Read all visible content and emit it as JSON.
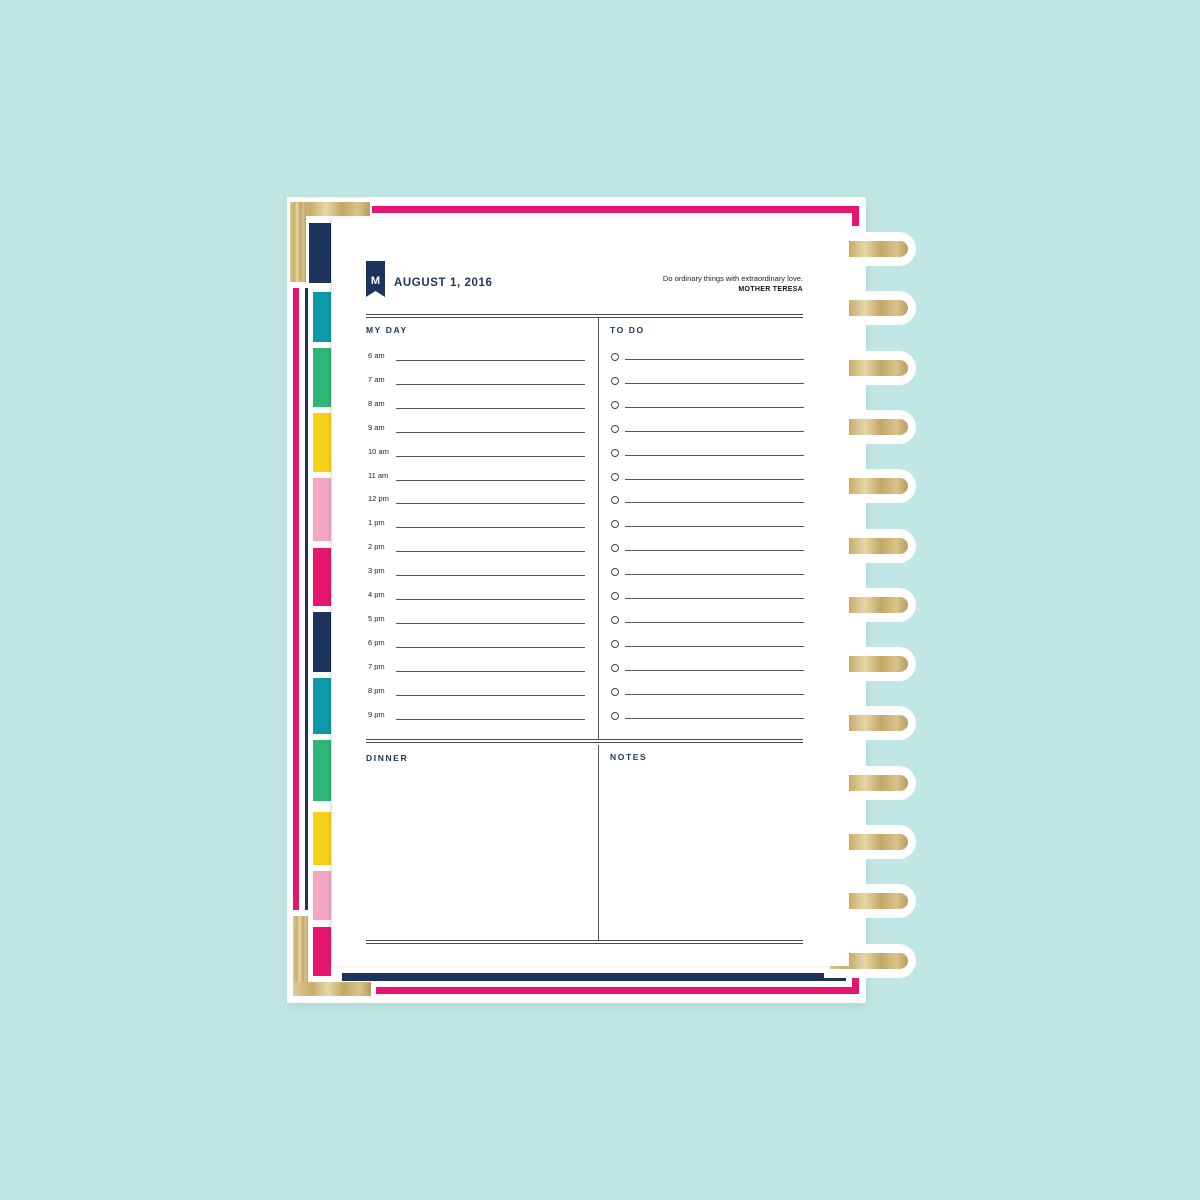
{
  "planner": {
    "date": "AUGUST 1, 2016",
    "monogram": "M",
    "quote": "Do ordinary things with extraordinary love.",
    "quote_author": "MOTHER TERESA",
    "sections": {
      "my_day": "MY DAY",
      "to_do": "TO DO",
      "dinner": "DINNER",
      "notes": "NOTES"
    },
    "hours": [
      "6 am",
      "7 am",
      "8 am",
      "9 am",
      "10 am",
      "11 am",
      "12 pm",
      "1 pm",
      "2 pm",
      "3 pm",
      "4 pm",
      "5 pm",
      "6 pm",
      "7 pm",
      "8 pm",
      "9 pm"
    ],
    "todo_count": 16,
    "ring_count": 13
  },
  "colors": {
    "background": "#c0e7e6",
    "pink": "#e6166e",
    "navy": "#1c335c",
    "teal": "#0d9aa8",
    "green": "#2fb575",
    "yellow": "#f7d117",
    "light_pink": "#f3a7c5",
    "gold": "#c9ae6c"
  },
  "tabs": [
    "navy",
    "teal",
    "green",
    "yellow",
    "light_pink",
    "pink",
    "navy",
    "teal",
    "green",
    "yellow",
    "light_pink",
    "pink"
  ]
}
